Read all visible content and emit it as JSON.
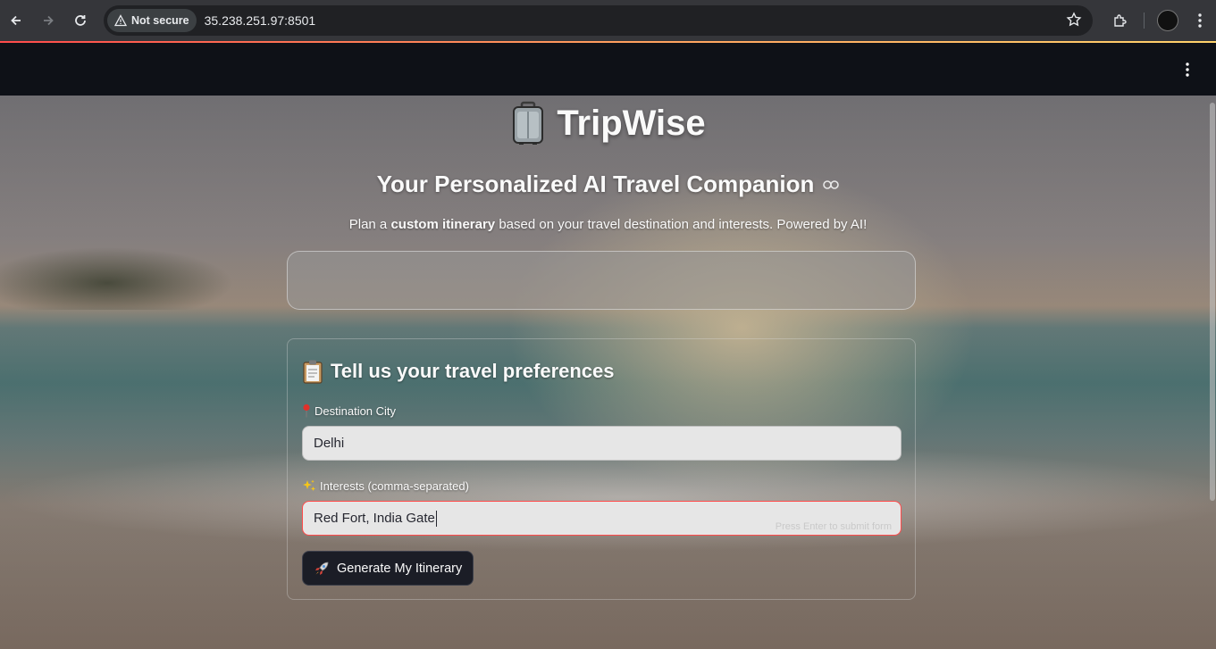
{
  "browser": {
    "security_label": "Not secure",
    "url": "35.238.251.97:8501"
  },
  "app": {
    "title": "TripWise",
    "title_icon": "luggage-icon",
    "subtitle": "Your Personalized AI Travel Companion",
    "tagline": {
      "prefix": "Plan a ",
      "bold": "custom itinerary",
      "suffix": " based on your travel destination and interests. Powered by AI!"
    }
  },
  "form": {
    "heading": "Tell us your travel preferences",
    "heading_icon": "clipboard-icon",
    "destination_label": "Destination City",
    "destination_icon": "pin-icon",
    "destination_value": "Delhi",
    "interests_label": "Interests (comma-separated)",
    "interests_icon": "sparkles-icon",
    "interests_value": "Red Fort, India Gate",
    "interests_hint": "Press Enter to submit form",
    "submit_label": "Generate My Itinerary",
    "submit_icon": "rocket-icon"
  }
}
